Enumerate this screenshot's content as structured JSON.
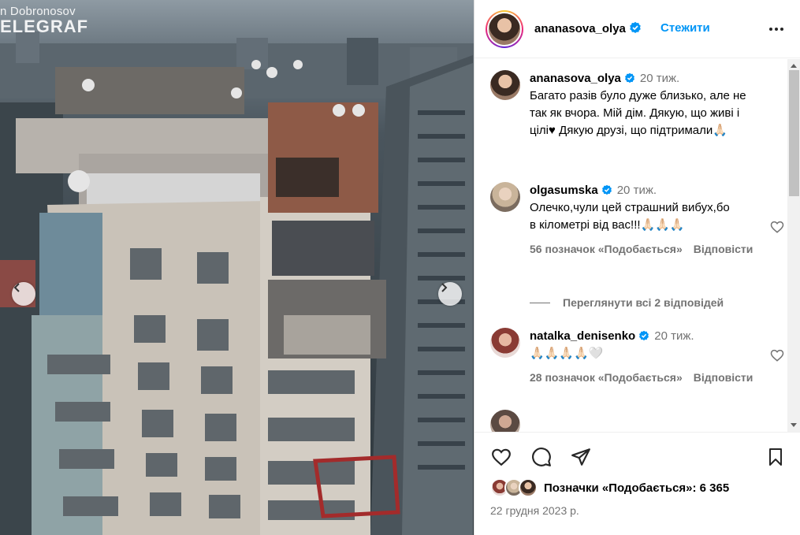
{
  "media": {
    "watermark_author": "n Dobronosov",
    "watermark_brand": "ELEGRAF"
  },
  "post": {
    "author": "ananasova_olya",
    "follow_label": "Стежити"
  },
  "caption": {
    "user": "ananasova_olya",
    "time": "20 тиж.",
    "text": "Багато разів було дуже близько, але не так як вчора. Мій дім. Дякую, що живі і цілі♥ Дякую друзі, що підтримали🙏🏻"
  },
  "comments": [
    {
      "user": "olgasumska",
      "time": "20 тиж.",
      "text": "Олечко,чули цей страшний вибух,бо в кілометрі від вас!!!🙏🏻🙏🏻🙏🏻",
      "likes": "56 позначок «Подобається»",
      "reply": "Відповісти"
    },
    {
      "user": "natalka_denisenko",
      "time": "20 тиж.",
      "text": "🙏🏻🙏🏻🙏🏻🙏🏻🤍",
      "likes": "28 позначок «Подобається»",
      "reply": "Відповісти"
    }
  ],
  "view_replies": "Переглянути всі 2 відповідей",
  "likes_summary": "Позначки «Подобається»: 6 365",
  "date": "22 грудня 2023 р.",
  "colors": {
    "accent": "#0095f6",
    "verified": "#0095f6",
    "secondary_text": "#737373"
  }
}
